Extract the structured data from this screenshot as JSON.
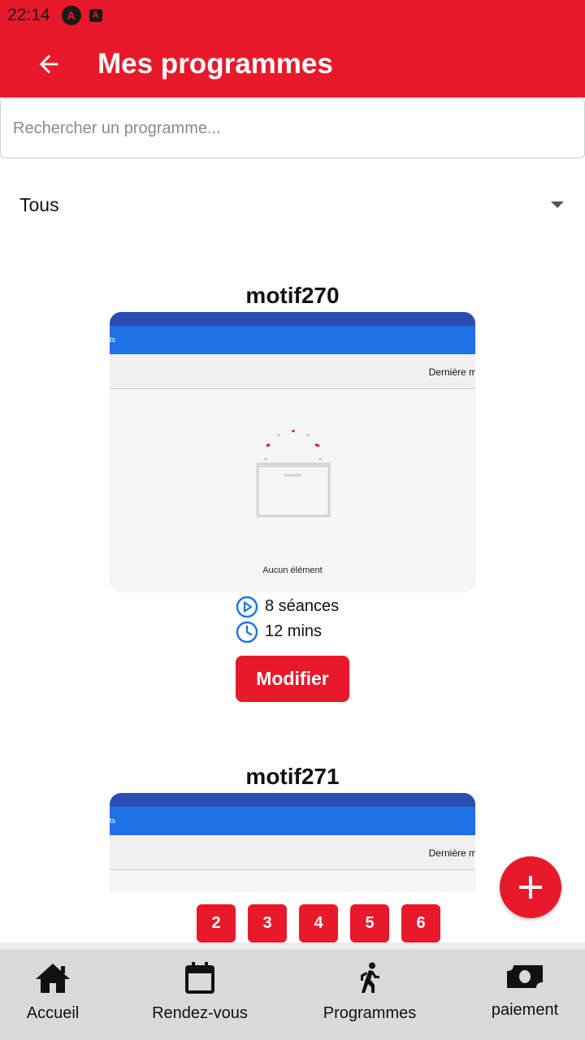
{
  "status_bar": {
    "time": "22:14",
    "icons": [
      "app-a-icon",
      "app-a-square-icon"
    ]
  },
  "app_bar": {
    "title": "Mes programmes",
    "back_icon": "arrow-left-icon"
  },
  "search": {
    "placeholder": "Rechercher un programme...",
    "value": ""
  },
  "filter": {
    "selected": "Tous"
  },
  "programs": [
    {
      "title": "motif270",
      "preview": {
        "header_fragment": "ts",
        "subheader_fragment": "Dernière m",
        "empty_label": "Aucun élément"
      },
      "sessions": "8 séances",
      "duration": "12 mins",
      "modify_label": "Modifier"
    },
    {
      "title": "motif271",
      "preview": {
        "header_fragment": "ts",
        "subheader_fragment": "Dernière m"
      }
    }
  ],
  "pagination": [
    "2",
    "3",
    "4",
    "5",
    "6"
  ],
  "fab": {
    "icon": "plus-icon"
  },
  "bottom_nav": [
    {
      "label": "Accueil",
      "icon": "home-icon"
    },
    {
      "label": "Rendez-vous",
      "icon": "calendar-icon"
    },
    {
      "label": "Programmes",
      "icon": "walking-icon"
    },
    {
      "label": "paiement",
      "icon": "cash-icon"
    }
  ],
  "colors": {
    "primary": "#e8192b",
    "preview_header": "#1f72e6",
    "preview_top": "#2a4db4",
    "icon_blue": "#1a73e8",
    "nav_bg": "#d9d9d9"
  }
}
